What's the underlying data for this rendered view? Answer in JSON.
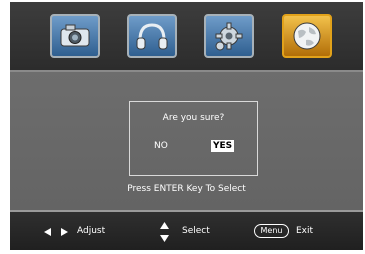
{
  "top_tabs": [
    {
      "icon": "camera-icon",
      "active": false
    },
    {
      "icon": "headphones-icon",
      "active": false
    },
    {
      "icon": "gear-icon",
      "active": false
    },
    {
      "icon": "globe-icon",
      "active": true
    }
  ],
  "dialog": {
    "title": "Are you sure?",
    "no_label": "NO",
    "yes_label": "YES",
    "selected": "YES"
  },
  "hint": "Press ENTER Key To Select",
  "bottom_legend": {
    "adjust_label": "Adjust",
    "select_label": "Select",
    "menu_key": "Menu",
    "exit_label": "Exit"
  },
  "colors": {
    "accent_active": "#e2a21a",
    "tab_blue": "#2f5f90",
    "panel_gray": "#6b6b6b"
  }
}
